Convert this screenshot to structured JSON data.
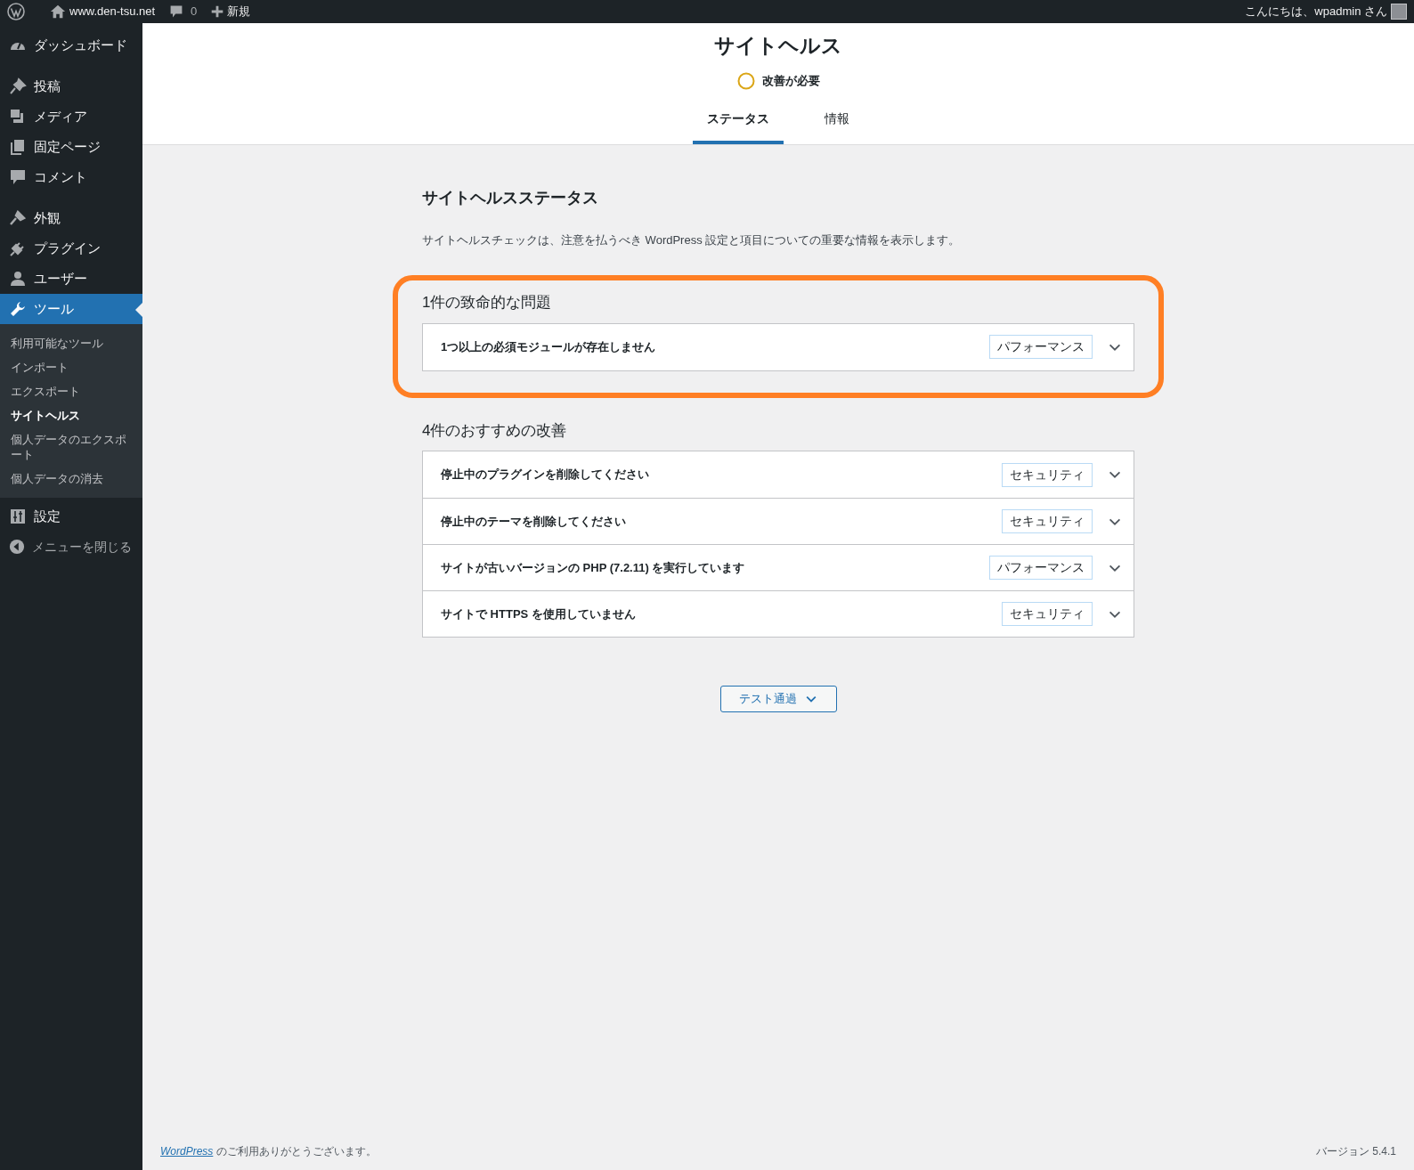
{
  "admin_bar": {
    "site": "www.den-tsu.net",
    "comments": "0",
    "new": "新規",
    "greeting": "こんにちは、wpadmin さん"
  },
  "sidebar": {
    "menu_groups": [
      [
        {
          "label": "ダッシュボード",
          "selected": false
        }
      ],
      [
        {
          "label": "投稿",
          "selected": false
        },
        {
          "label": "メディア",
          "selected": false
        },
        {
          "label": "固定ページ",
          "selected": false
        },
        {
          "label": "コメント",
          "selected": false
        }
      ],
      [
        {
          "label": "外観",
          "selected": false
        },
        {
          "label": "プラグイン",
          "selected": false
        },
        {
          "label": "ユーザー",
          "selected": false
        },
        {
          "label": "ツール",
          "selected": true,
          "submenu": [
            {
              "label": "利用可能なツール",
              "selected": false
            },
            {
              "label": "インポート",
              "selected": false
            },
            {
              "label": "エクスポート",
              "selected": false
            },
            {
              "label": "サイトヘルス",
              "selected": true
            },
            {
              "label": "個人データのエクスポート",
              "selected": false
            },
            {
              "label": "個人データの消去",
              "selected": false
            }
          ]
        },
        {
          "label": "設定",
          "selected": false
        }
      ]
    ],
    "collapse": "メニューを閉じる"
  },
  "header": {
    "title": "サイトヘルス",
    "status": "改善が必要",
    "tabs": [
      {
        "label": "ステータス",
        "selected": true
      },
      {
        "label": "情報",
        "selected": false
      }
    ]
  },
  "main": {
    "heading": "サイトヘルスステータス",
    "description": "サイトヘルスチェックは、注意を払うべき WordPress 設定と項目についての重要な情報を表示します。",
    "sections": [
      {
        "title": "1件の致命的な問題",
        "highlighted": true,
        "issues": [
          {
            "text": "1つ以上の必須モジュールが存在しません",
            "tag": "パフォーマンス",
            "expanded": false
          }
        ]
      },
      {
        "title": "4件のおすすめの改善",
        "highlighted": false,
        "issues": [
          {
            "text": "停止中のプラグインを削除してください",
            "tag": "セキュリティ",
            "expanded": false
          },
          {
            "text": "停止中のテーマを削除してください",
            "tag": "セキュリティ",
            "expanded": false
          },
          {
            "text": "サイトが古いバージョンの PHP (7.2.11) を実行しています",
            "tag": "パフォーマンス",
            "expanded": false
          },
          {
            "text": "サイトで HTTPS を使用していません",
            "tag": "セキュリティ",
            "expanded": false
          }
        ]
      }
    ],
    "passed_button": "テスト通過"
  },
  "footer": {
    "link": "WordPress",
    "text": " のご利用ありがとうございます。",
    "version": "バージョン 5.4.1"
  }
}
